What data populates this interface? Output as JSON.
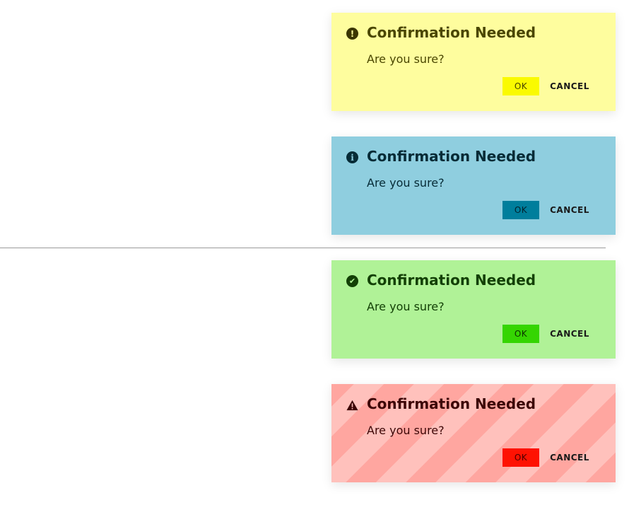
{
  "dialogs": [
    {
      "variant": "warning",
      "icon": "exclamation-circle-icon",
      "icon_glyph": "!",
      "title": "Confirmation Needed",
      "message": "Are you sure?",
      "ok_label": "OK",
      "cancel_label": "CANCEL",
      "background": "#fefd9e",
      "ok_color": "#fafa00"
    },
    {
      "variant": "info",
      "icon": "info-circle-icon",
      "icon_glyph": "i",
      "title": "Confirmation Needed",
      "message": "Are you sure?",
      "ok_label": "OK",
      "cancel_label": "CANCEL",
      "background": "#8fcedf",
      "ok_color": "#007e9c"
    },
    {
      "variant": "success",
      "icon": "check-circle-icon",
      "icon_glyph": "✔",
      "title": "Confirmation Needed",
      "message": "Are you sure?",
      "ok_label": "OK",
      "cancel_label": "CANCEL",
      "background": "#b0f297",
      "ok_color": "#35d502"
    },
    {
      "variant": "danger",
      "icon": "warning-triangle-icon",
      "title": "Confirmation Needed",
      "message": "Are you sure?",
      "ok_label": "OK",
      "cancel_label": "CANCEL",
      "background": "#ffa6a0",
      "ok_color": "#fe1202"
    }
  ]
}
